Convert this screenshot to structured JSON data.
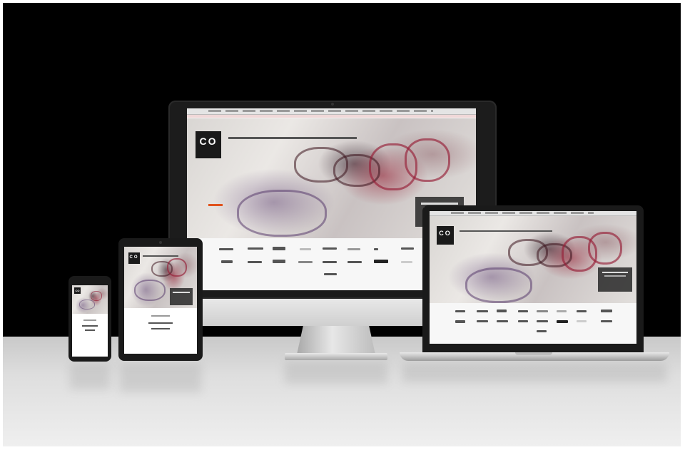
{
  "scene": {
    "background_color": "#000000",
    "floor_color": "#d8d8d8"
  },
  "site": {
    "logo_text": "CO",
    "logo_subtext": "",
    "nav_text": "",
    "promo_lines": []
  },
  "icons": {
    "imac": "desktop-monitor-icon",
    "laptop": "laptop-icon",
    "tablet": "tablet-icon",
    "phone": "smartphone-icon"
  }
}
